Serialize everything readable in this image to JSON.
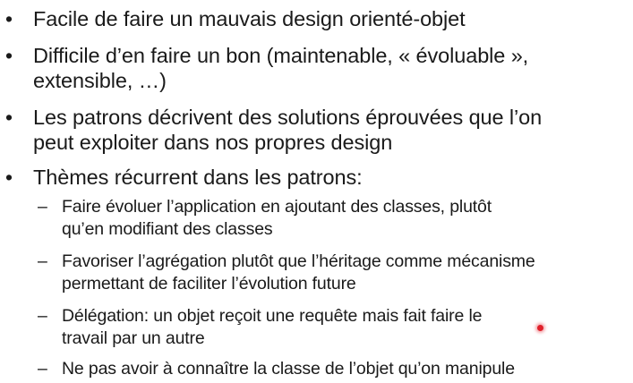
{
  "slide": {
    "bullets": [
      {
        "marker": "•",
        "lines": [
          "Facile de faire un mauvais design orienté-objet"
        ]
      },
      {
        "marker": "•",
        "lines": [
          "Difficile d’en faire un bon (maintenable, « évoluable »,",
          "extensible, …)"
        ]
      },
      {
        "marker": "•",
        "lines": [
          "Les patrons décrivent des solutions éprouvées que l’on",
          "peut exploiter dans nos propres design"
        ]
      },
      {
        "marker": "•",
        "lines": [
          "Thèmes récurrent dans les patrons:"
        ]
      }
    ],
    "subitems": [
      {
        "marker": "–",
        "lines": [
          "Faire évoluer l’application en ajoutant des classes, plutôt",
          "qu’en modifiant des classes"
        ]
      },
      {
        "marker": "–",
        "lines": [
          "Favoriser l’agrégation plutôt que l’héritage comme mécanisme",
          "permettant de faciliter l’évolution future"
        ]
      },
      {
        "marker": "–",
        "lines": [
          "Délégation: un objet reçoit une requête mais fait faire le",
          "travail par un autre"
        ]
      },
      {
        "marker": "–",
        "lines": [
          "Ne pas avoir à connaître la classe de l’objet qu’on manipule"
        ]
      }
    ]
  },
  "pointer": {
    "color": "#e0202a"
  }
}
